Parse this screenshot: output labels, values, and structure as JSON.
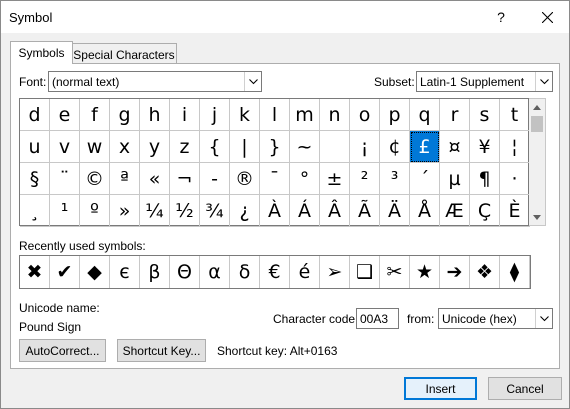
{
  "window": {
    "title": "Symbol",
    "help_label": "?"
  },
  "tabs": [
    {
      "label": "Symbols",
      "active": true
    },
    {
      "label": "Special Characters",
      "active": false
    }
  ],
  "font": {
    "label": "Font:",
    "value": "(normal text)"
  },
  "subset": {
    "label": "Subset:",
    "value": "Latin-1 Supplement"
  },
  "symbol_grid": {
    "rows": [
      [
        "d",
        "e",
        "f",
        "g",
        "h",
        "i",
        "j",
        "k",
        "l",
        "m",
        "n",
        "o",
        "p",
        "q",
        "r",
        "s",
        "t"
      ],
      [
        "u",
        "v",
        "w",
        "x",
        "y",
        "z",
        "{",
        "|",
        "}",
        "~",
        "",
        "¡",
        "¢",
        "£",
        "¤",
        "¥",
        "¦"
      ],
      [
        "§",
        "¨",
        "©",
        "ª",
        "«",
        "¬",
        "-",
        "®",
        "¯",
        "°",
        "±",
        "²",
        "³",
        "´",
        "µ",
        "¶",
        "·"
      ],
      [
        "¸",
        "¹",
        "º",
        "»",
        "¼",
        "½",
        "¾",
        "¿",
        "À",
        "Á",
        "Â",
        "Ã",
        "Ä",
        "Å",
        "Æ",
        "Ç",
        "È"
      ]
    ],
    "selected": "£"
  },
  "recent": {
    "label": "Recently used symbols:",
    "symbols": [
      "✖",
      "✔",
      "◆",
      "є",
      "β",
      "Θ",
      "α",
      "δ",
      "€",
      "é",
      "➢",
      "❑",
      "✂",
      "★",
      "➔",
      "❖",
      "⧫"
    ]
  },
  "unicode_name": {
    "label": "Unicode name:",
    "value": "Pound Sign"
  },
  "character_code": {
    "label": "Character code:",
    "value": "00A3"
  },
  "from": {
    "label": "from:",
    "value": "Unicode (hex)"
  },
  "buttons": {
    "autocorrect": "AutoCorrect...",
    "shortcut_key": "Shortcut Key...",
    "insert": "Insert",
    "cancel": "Cancel"
  },
  "shortcut_text": "Shortcut key: Alt+0163",
  "colors": {
    "accent": "#0078d7",
    "dialog_bg": "#f0f0f0"
  }
}
